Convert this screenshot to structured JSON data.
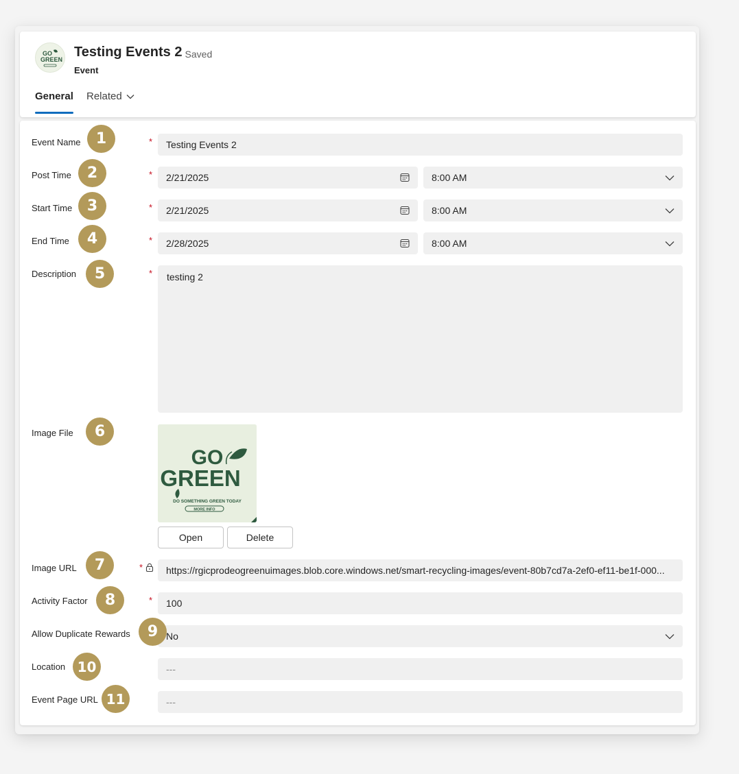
{
  "record": {
    "title": "Testing Events 2",
    "saved_status": "- Saved",
    "entity": "Event"
  },
  "tabs": {
    "general": "General",
    "related": "Related"
  },
  "fields": {
    "event_name": {
      "label": "Event Name",
      "value": "Testing Events 2",
      "badge": "1"
    },
    "post_time": {
      "label": "Post Time",
      "date": "2/21/2025",
      "time": "8:00 AM",
      "badge": "2"
    },
    "start_time": {
      "label": "Start Time",
      "date": "2/21/2025",
      "time": "8:00 AM",
      "badge": "3"
    },
    "end_time": {
      "label": "End Time",
      "date": "2/28/2025",
      "time": "8:00 AM",
      "badge": "4"
    },
    "description": {
      "label": "Description",
      "value": "testing 2",
      "badge": "5"
    },
    "image_file": {
      "label": "Image File",
      "badge": "6",
      "open_label": "Open",
      "delete_label": "Delete",
      "image_text_line1": "GO",
      "image_text_line2": "GREEN",
      "image_tagline": "DO SOMETHING GREEN TODAY",
      "image_button": "MORE INFO"
    },
    "image_url": {
      "label": "Image URL",
      "value": "https://rgicprodeogreenuimages.blob.core.windows.net/smart-recycling-images/event-80b7cd7a-2ef0-ef11-be1f-000...",
      "badge": "7"
    },
    "activity_factor": {
      "label": "Activity Factor",
      "value": "100",
      "badge": "8"
    },
    "allow_duplicate_rewards": {
      "label": "Allow Duplicate Rewards",
      "value": "No",
      "badge": "9"
    },
    "location": {
      "label": "Location",
      "value": "---",
      "badge": "10"
    },
    "event_page_url": {
      "label": "Event Page URL",
      "value": "---",
      "badge": "11"
    }
  },
  "required_marker": "*",
  "icons": {
    "avatar": "go-green-logo",
    "related": "chevron-down-icon",
    "date": "calendar-icon",
    "time": "chevron-down-icon",
    "lock": "lock-icon"
  },
  "colors": {
    "accent": "#0f6cbd",
    "required": "#c50f1f",
    "badge": "#b39a5a",
    "field_bg": "#f0f0f0",
    "logo_green": "#2e5a3f"
  }
}
